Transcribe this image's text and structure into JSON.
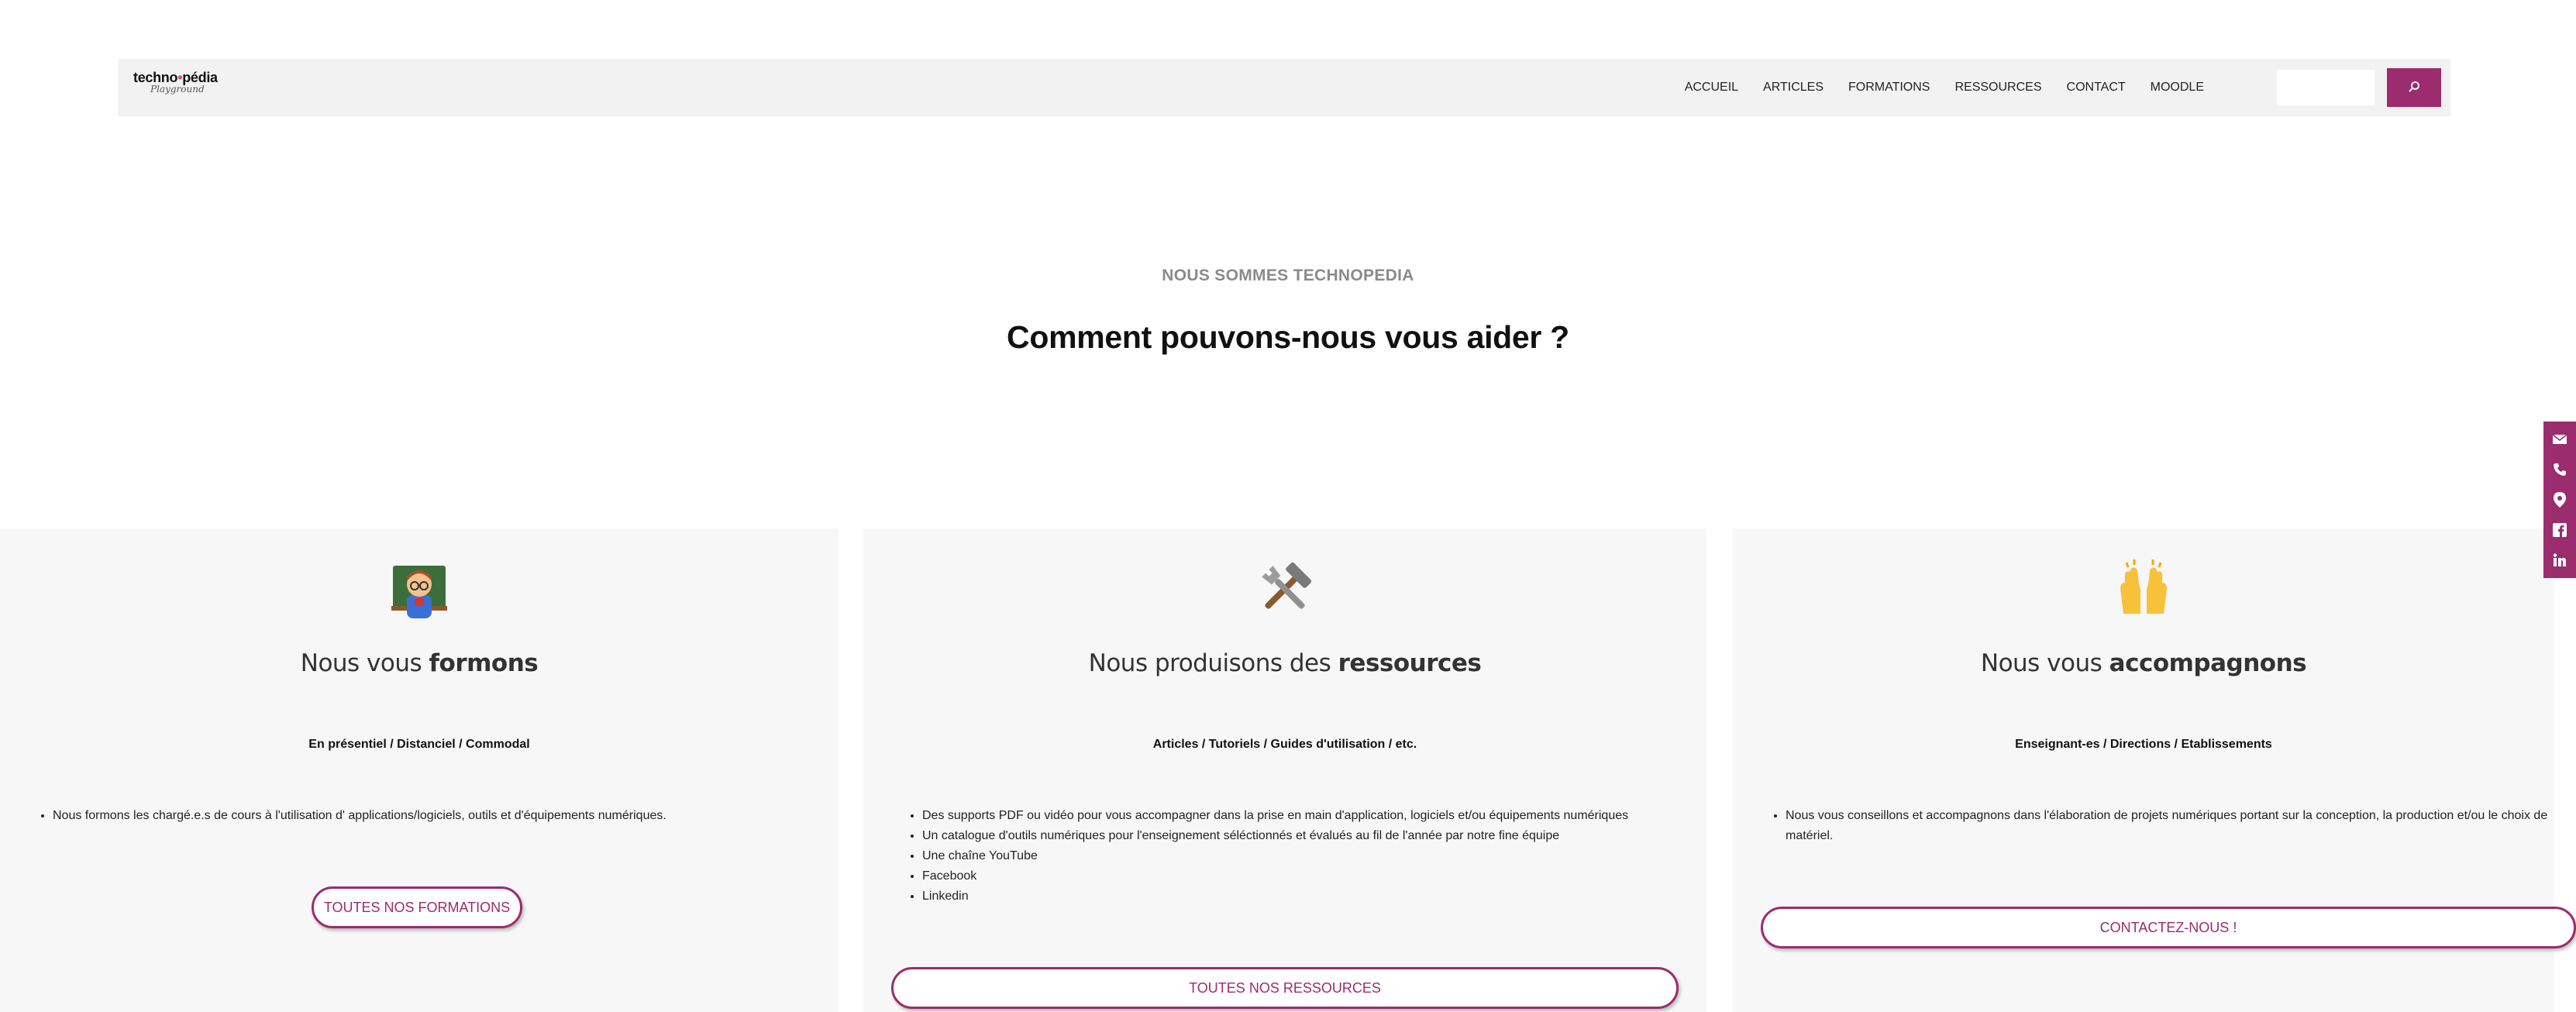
{
  "header": {
    "logo": {
      "main_prefix": "techno",
      "main_suffix": "pédia",
      "sub": "Playground"
    },
    "nav": [
      "ACCUEIL",
      "ARTICLES",
      "FORMATIONS",
      "RESSOURCES",
      "CONTACT",
      "MOODLE"
    ],
    "search": {
      "placeholder": "",
      "value": "",
      "icon": "search-icon"
    }
  },
  "hero": {
    "eyebrow": "NOUS SOMMES TECHNOPEDIA",
    "headline": "Comment pouvons-nous vous aider ?"
  },
  "cards": [
    {
      "icon": "teacher-emoji",
      "title_prefix": "Nous vous ",
      "title_bold": "formons",
      "subtitle": "En présentiel / Distanciel / Commodal",
      "bullets": [
        "Nous formons les chargé.e.s de cours à l'utilisation d' applications/logiciels, outils et d'équipements numériques."
      ],
      "button": "TOUTES NOS FORMATIONS"
    },
    {
      "icon": "tools-emoji",
      "title_prefix": "Nous produisons des ",
      "title_bold": "ressources",
      "subtitle": "Articles / Tutoriels / Guides d'utilisation / etc.",
      "bullets": [
        "Des supports PDF ou vidéo pour vous accompagner dans la prise en main d'application, logiciels et/ou équipements numériques",
        "Un catalogue d'outils numériques pour l'enseignement séléctionnés et évalués au fil de l'année par notre fine équipe",
        "Une chaîne YouTube",
        "Facebook",
        "Linkedin"
      ],
      "button": "TOUTES NOS RESSOURCES"
    },
    {
      "icon": "raising-hands-emoji",
      "title_prefix": "Nous vous ",
      "title_bold": "accompagnons",
      "subtitle": "Enseignant-es / Directions / Etablissements",
      "bullets": [
        "Nous vous conseillons et accompagnons dans l'élaboration de projets numériques portant sur la conception, la production et/ou le choix de matériel."
      ],
      "button": "CONTACTEZ-NOUS !"
    }
  ],
  "social": [
    "email-icon",
    "phone-icon",
    "location-icon",
    "facebook-icon",
    "linkedin-icon"
  ],
  "colors": {
    "accent": "#9b2c6d",
    "header_bg": "#f2f2f2",
    "card_bg": "#f7f7f7"
  }
}
